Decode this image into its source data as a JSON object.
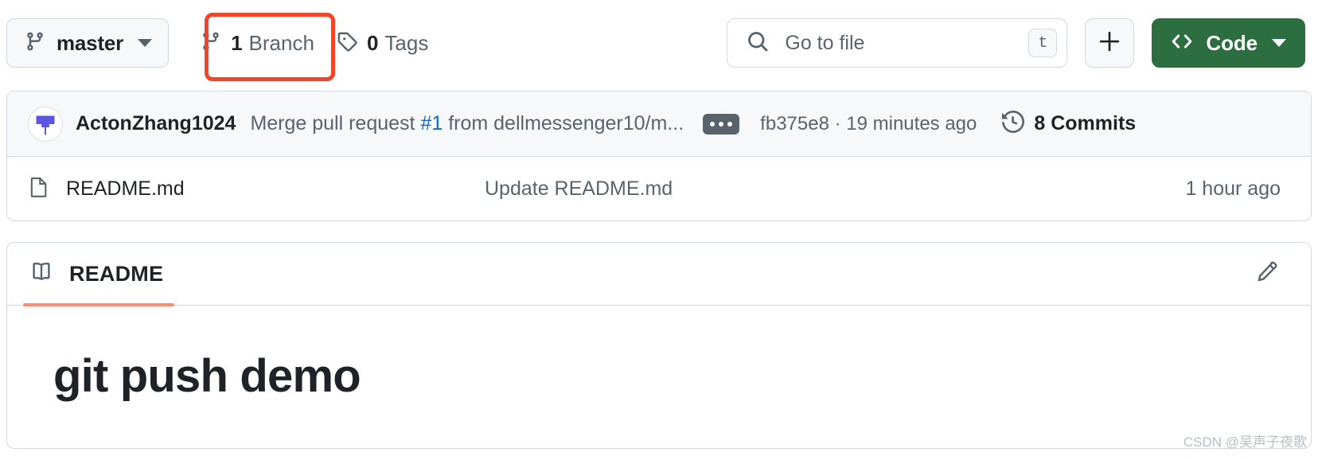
{
  "toolbar": {
    "branch_label": "master",
    "branch_icon": "git-branch-icon",
    "branches": {
      "count": "1",
      "word": "Branch",
      "icon": "git-branch-icon"
    },
    "tags": {
      "count": "0",
      "word": "Tags",
      "icon": "tag-icon"
    },
    "search": {
      "placeholder": "Go to file",
      "icon": "search-icon",
      "shortcut": "t"
    },
    "add_button_icon": "plus-icon",
    "code_button": {
      "label": "Code",
      "icon": "code-brackets-icon",
      "color": "#2c6e3f"
    }
  },
  "annotation": {
    "color": "#f0452b",
    "target": "branches-metric"
  },
  "commit_row": {
    "author": "ActonZhang1024",
    "message_prefix": "Merge pull request ",
    "pr_number": "#1",
    "message_suffix": " from dellmessenger10/m...",
    "more_icon": "ellipsis-icon",
    "sha": "fb375e8",
    "separator": " · ",
    "relative_time": "19 minutes ago",
    "commits_label": "8 Commits",
    "commits_icon": "history-clock-icon"
  },
  "files": {
    "rows": [
      {
        "name": "README.md",
        "icon": "file-icon",
        "commit_message": "Update README.md",
        "time": "1 hour ago"
      }
    ]
  },
  "readme": {
    "tab_label": "README",
    "tab_icon": "book-icon",
    "tab_accent": "#fd8c73",
    "edit_icon": "pencil-icon",
    "heading": "git push demo"
  },
  "watermark": {
    "text": "CSDN @吴声子夜歌"
  }
}
